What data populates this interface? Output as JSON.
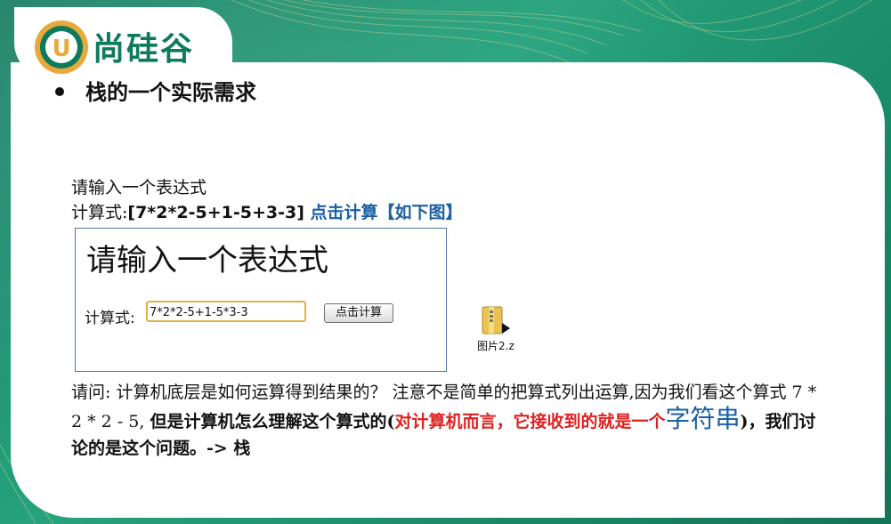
{
  "logo": {
    "letter": "U",
    "brand": "尚硅谷"
  },
  "slide": {
    "bullet_title": "栈的一个实际需求"
  },
  "intro": {
    "line1": "请输入一个表达式",
    "line2_prefix": "计算式:",
    "line2_expr": "[7*2*2-5+1-5+3-3]",
    "line2_action": " 点击计算【如下图】"
  },
  "demo": {
    "title": "请输入一个表达式",
    "label": "计算式:",
    "input_value": "7*2*2-5+1-5*3-3",
    "button_label": "点击计算"
  },
  "file": {
    "label": "图片2.z"
  },
  "paragraph": {
    "part1": "请问: 计算机底层是如何运算得到结果的？ 注意不是简单的把算式列出运算,因为我们看这个算式 7 * 2 * 2 - 5, ",
    "part2": "但是计算机怎么理解这个算式的(",
    "part3": "对计算机而言，它接收到的就是一个",
    "part4": "字符串",
    "part5": ")，我们讨论的是这个问题。-> 栈"
  },
  "colors": {
    "brand_green": "#0d7a5c",
    "accent_blue": "#1b5fa6",
    "accent_red": "#e02020",
    "input_border": "#e5b04a"
  }
}
